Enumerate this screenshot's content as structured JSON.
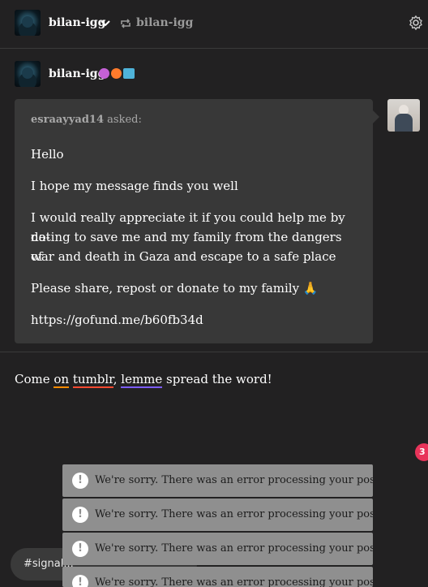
{
  "topbar": {
    "blog_name": "bilan-igg",
    "reblog_source": "bilan-igg",
    "icons": [
      "avatar",
      "chevron-down-icon",
      "reblog-icon",
      "gear-icon"
    ]
  },
  "post": {
    "blog_name": "bilan-igg",
    "badges": [
      "#c561d6",
      "#ff7b2c",
      "#4fb3d9"
    ],
    "ask": {
      "asker": "esraayyad14",
      "asked_label": "asked:",
      "paragraphs": [
        "Hello",
        "I hope my message finds you well",
        "I would really appreciate it if you could help me by do-nating to save me and my family from the dangers of war and death in Gaza and escape to a safe place",
        "Please share, repost or donate to my family 🙏",
        "https://gofund.me/b60fb34d"
      ],
      "lines": {
        "p3a": "I would really appreciate it if you could help me by do-",
        "p3b": "nating to save me and my family from the dangers of",
        "p3c": "war and death in Gaza and escape to a safe place"
      }
    },
    "reblog_text": {
      "part1": "Come ",
      "on": "on",
      "space": " ",
      "tumblr": "tumblr",
      "comma": ", ",
      "lemme": "lemme",
      "part2": " spread the word!"
    }
  },
  "notification_count": "3",
  "tag_input": "#signal...",
  "toasts": [
    "We're sorry. There was an error processing your post.",
    "We're sorry. There was an error processing your post.",
    "We're sorry. There was an error processing your post.",
    "We're sorry. There was an error processing your post."
  ],
  "colors": {
    "background": "#222122",
    "ask_box": "#383838",
    "toast": "#8f8f8f",
    "notification": "#e8345a"
  }
}
